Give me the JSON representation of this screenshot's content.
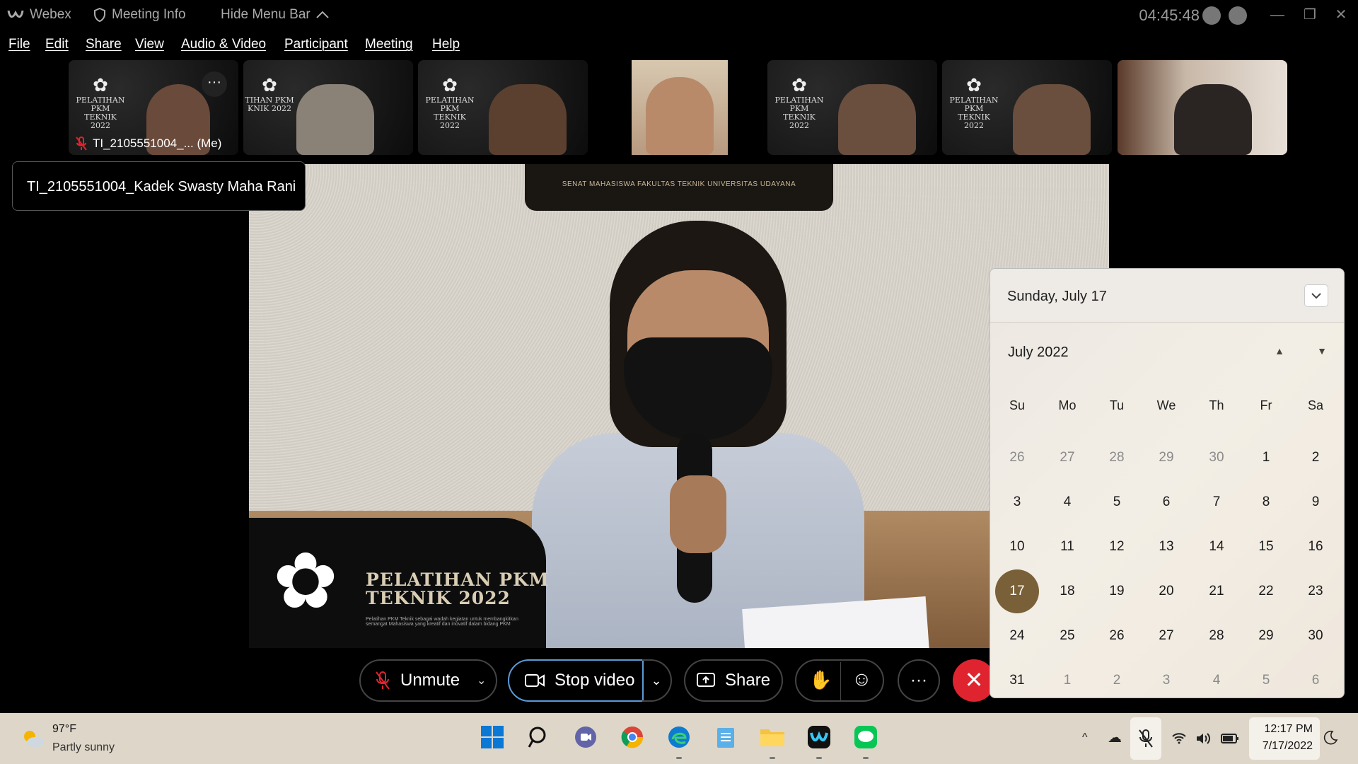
{
  "titlebar": {
    "app_name": "Webex",
    "meeting_info": "Meeting Info",
    "hide_menu_bar": "Hide Menu Bar",
    "clock": "04:45:48",
    "minimize": "—",
    "restore": "❐",
    "close": "✕"
  },
  "menu": [
    "File",
    "Edit",
    "Share",
    "View",
    "Audio & Video",
    "Participant",
    "Meeting",
    "Help"
  ],
  "thumbnails": {
    "me_label": "TI_2105551004_... (Me)",
    "more": "···",
    "logo_text": "PELATIHAN PKM TEKNIK 2022",
    "logo_partial": "TIHAN PKM KNIK 2022"
  },
  "name_tooltip": "TI_2105551004_Kadek Swasty Maha Rani",
  "main_video": {
    "banner": "SENAT MAHASISWA FAKULTAS TEKNIK UNIVERSITAS UDAYANA",
    "pkm_title_1": "PELATIHAN PKM",
    "pkm_title_2": "TEKNIK 2022",
    "pkm_sub": "Pelatihan PKM Teknik sebagai wadah kegiatan untuk membangkitkan semangat Mahasiswa yang kreatif dan inovatif dalam bidang PKM"
  },
  "controls": {
    "unmute": "Unmute",
    "stop_video": "Stop video",
    "share": "Share",
    "more": "···",
    "end": "✕",
    "chevron": "⌄"
  },
  "calendar": {
    "header_date": "Sunday, July 17",
    "month_label": "July 2022",
    "weekdays": [
      "Su",
      "Mo",
      "Tu",
      "We",
      "Th",
      "Fr",
      "Sa"
    ],
    "weeks": [
      [
        {
          "d": "26",
          "o": true
        },
        {
          "d": "27",
          "o": true
        },
        {
          "d": "28",
          "o": true
        },
        {
          "d": "29",
          "o": true
        },
        {
          "d": "30",
          "o": true
        },
        {
          "d": "1"
        },
        {
          "d": "2"
        }
      ],
      [
        {
          "d": "3"
        },
        {
          "d": "4"
        },
        {
          "d": "5"
        },
        {
          "d": "6"
        },
        {
          "d": "7"
        },
        {
          "d": "8"
        },
        {
          "d": "9"
        }
      ],
      [
        {
          "d": "10"
        },
        {
          "d": "11"
        },
        {
          "d": "12"
        },
        {
          "d": "13"
        },
        {
          "d": "14"
        },
        {
          "d": "15"
        },
        {
          "d": "16"
        }
      ],
      [
        {
          "d": "17",
          "t": true
        },
        {
          "d": "18"
        },
        {
          "d": "19"
        },
        {
          "d": "20"
        },
        {
          "d": "21"
        },
        {
          "d": "22"
        },
        {
          "d": "23"
        }
      ],
      [
        {
          "d": "24"
        },
        {
          "d": "25"
        },
        {
          "d": "26"
        },
        {
          "d": "27"
        },
        {
          "d": "28"
        },
        {
          "d": "29"
        },
        {
          "d": "30"
        }
      ],
      [
        {
          "d": "31"
        },
        {
          "d": "1",
          "o": true
        },
        {
          "d": "2",
          "o": true
        },
        {
          "d": "3",
          "o": true
        },
        {
          "d": "4",
          "o": true
        },
        {
          "d": "5",
          "o": true
        },
        {
          "d": "6",
          "o": true
        }
      ]
    ],
    "selected_date": "17",
    "accent": "#7a6038"
  },
  "taskbar": {
    "weather_temp": "97°F",
    "weather_cond": "Partly sunny",
    "time": "12:17 PM",
    "date": "7/17/2022",
    "apps": [
      "start-icon",
      "search-icon",
      "teams-chat-icon",
      "chrome-icon",
      "edge-icon",
      "notepad-icon",
      "file-explorer-icon",
      "webex-icon",
      "line-icon"
    ]
  },
  "colors": {
    "end_call": "#e0242f",
    "video_focus": "#5a9bd6",
    "taskbar_bg": "#ded6c8"
  }
}
